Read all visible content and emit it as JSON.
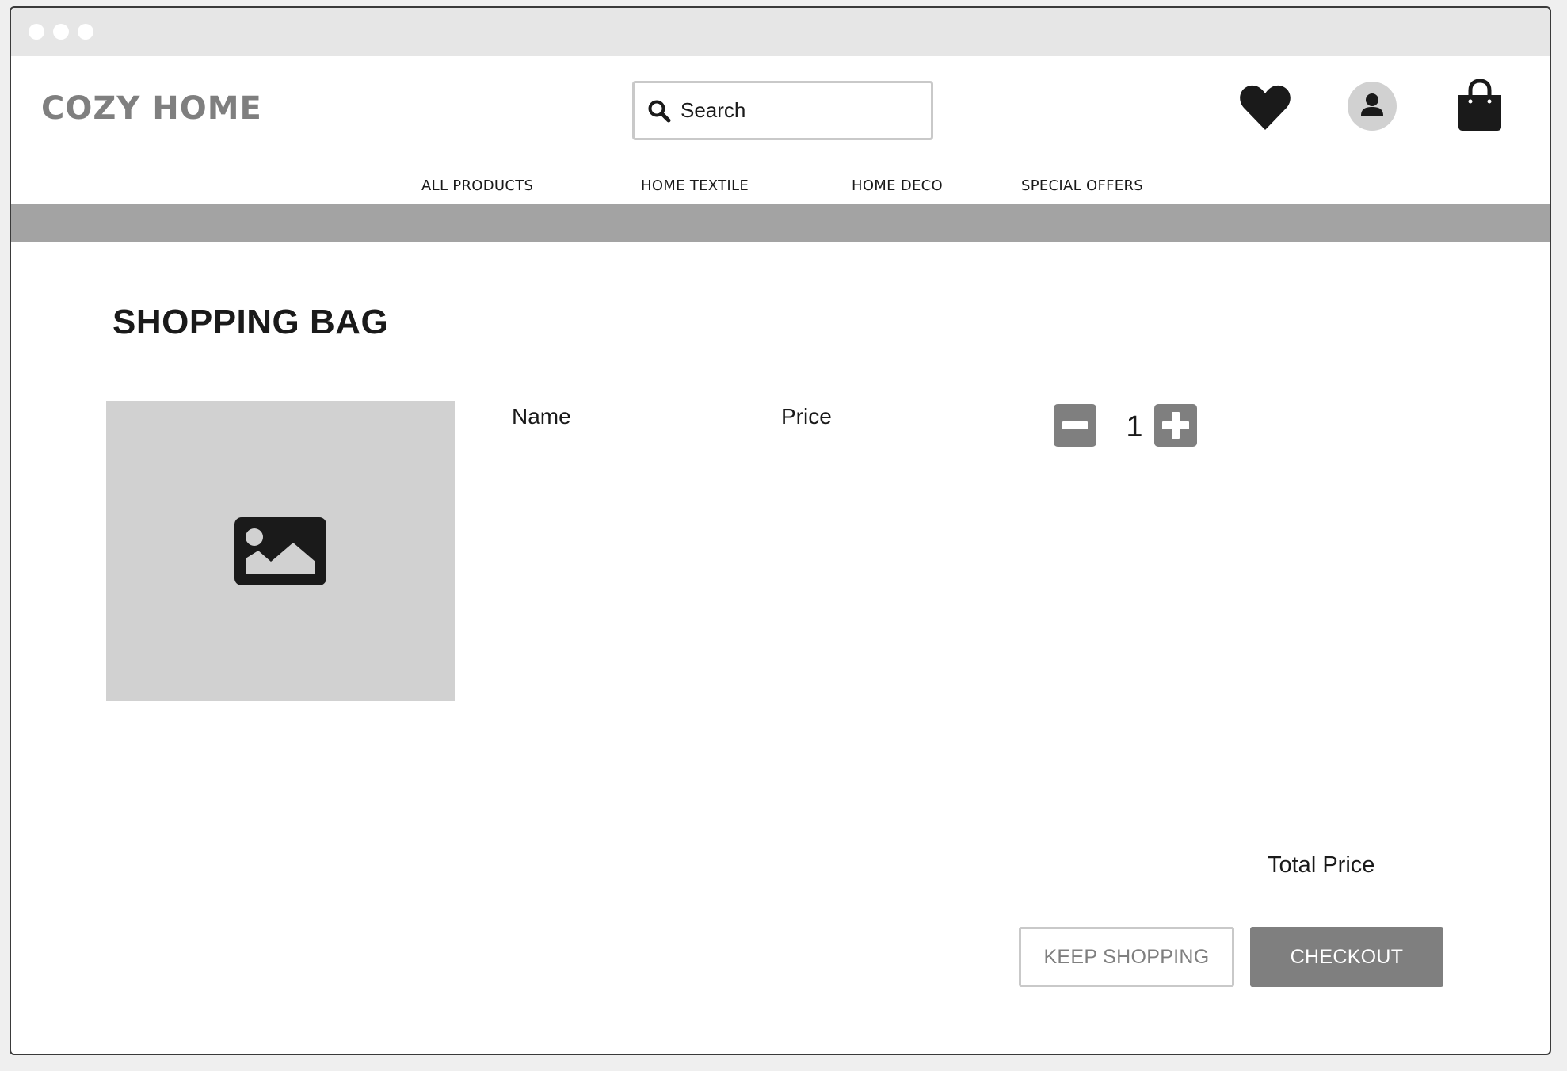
{
  "header": {
    "logo": "COZY HOME",
    "search_placeholder": "Search"
  },
  "nav": {
    "items": [
      "ALL PRODUCTS",
      "HOME TEXTILE",
      "HOME DECO",
      "SPECIAL OFFERS"
    ]
  },
  "page": {
    "title": "SHOPPING BAG"
  },
  "cart": {
    "item": {
      "name_label": "Name",
      "price_label": "Price",
      "quantity": "1"
    },
    "total_label": "Total Price",
    "keep_shopping_label": "KEEP SHOPPING",
    "checkout_label": "CHECKOUT"
  },
  "icons": {
    "search": "search-icon",
    "favorites": "heart-icon",
    "account": "user-icon",
    "bag": "shopping-bag-icon",
    "image_placeholder": "image-icon",
    "decrease": "minus-icon",
    "increase": "plus-icon"
  },
  "colors": {
    "accent": "#7f7f7f",
    "band": "#a3a3a3",
    "placeholder": "#d1d1d1",
    "icon_dark": "#1a1a1a"
  }
}
